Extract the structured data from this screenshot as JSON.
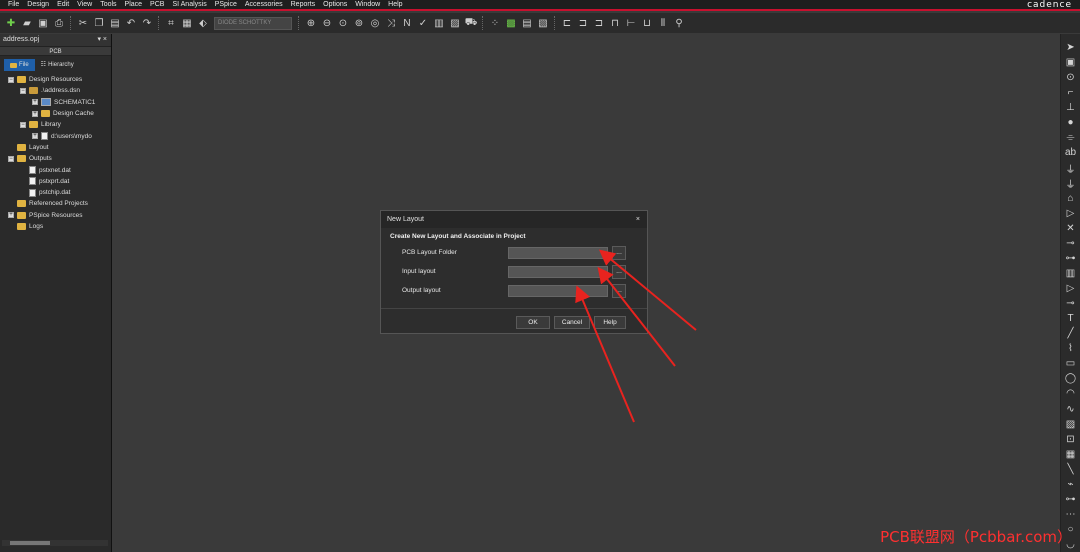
{
  "menu": [
    "File",
    "Design",
    "Edit",
    "View",
    "Tools",
    "Place",
    "PCB",
    "SI Analysis",
    "PSpice",
    "Accessories",
    "Reports",
    "Options",
    "Window",
    "Help"
  ],
  "brand": "cadence",
  "toolbar": {
    "part_select_value": "DIODE SCHOTTKY",
    "icons_left": [
      "new-icon",
      "open-icon",
      "save-icon",
      "print-icon",
      "cut-icon",
      "copy-icon",
      "paste-icon",
      "undo-icon",
      "redo-icon",
      "grid-icon",
      "snap-icon",
      "part-icon"
    ],
    "icons_mid": [
      "zoom-in-icon",
      "zoom-out-icon",
      "zoom-area-icon",
      "zoom-all-icon",
      "fit-icon",
      "cross-probe-icon",
      "netlist-icon",
      "drc-icon",
      "bom-icon",
      "library-icon",
      "cart-icon"
    ],
    "icons_right": [
      "annotate-icon",
      "pcb-editor-icon",
      "report-icon",
      "browse-icon",
      "align-left-icon",
      "align-center-icon",
      "align-right-icon",
      "align-top-icon",
      "align-middle-icon",
      "align-bottom-icon",
      "distribute-icon",
      "pin-icon"
    ]
  },
  "left_panel": {
    "title": "address.opj",
    "close_glyph": "▾ ×",
    "subtitle": "PCB",
    "tabs": [
      "File",
      "Hierarchy"
    ],
    "tree": [
      {
        "indent": 0,
        "type": "folder",
        "label": "Design Resources",
        "expander": "−"
      },
      {
        "indent": 1,
        "type": "dsn",
        "label": ".\\address.dsn",
        "expander": "−"
      },
      {
        "indent": 2,
        "type": "schem",
        "label": "SCHEMATIC1",
        "expander": "+"
      },
      {
        "indent": 2,
        "type": "folder",
        "label": "Design Cache",
        "expander": "+"
      },
      {
        "indent": 1,
        "type": "folder",
        "label": "Library",
        "expander": "−"
      },
      {
        "indent": 2,
        "type": "file",
        "label": "d:\\users\\mydo",
        "expander": "+"
      },
      {
        "indent": 0,
        "type": "folder",
        "label": "Layout",
        "expander": ""
      },
      {
        "indent": 0,
        "type": "folder",
        "label": "Outputs",
        "expander": "−"
      },
      {
        "indent": 1,
        "type": "file",
        "label": "pstxnet.dat",
        "expander": ""
      },
      {
        "indent": 1,
        "type": "file",
        "label": "pstxprt.dat",
        "expander": ""
      },
      {
        "indent": 1,
        "type": "file",
        "label": "pstchip.dat",
        "expander": ""
      },
      {
        "indent": 0,
        "type": "folder",
        "label": "Referenced Projects",
        "expander": ""
      },
      {
        "indent": 0,
        "type": "folder",
        "label": "PSpice Resources",
        "expander": "+"
      },
      {
        "indent": 0,
        "type": "folder",
        "label": "Logs",
        "expander": ""
      }
    ]
  },
  "right_toolbar": [
    "select-icon",
    "place-part-icon",
    "place-net-icon",
    "wire-icon",
    "bus-icon",
    "junction-icon",
    "bus-entry-icon",
    "net-alias-icon",
    "power-icon",
    "ground-icon",
    "off-page-icon",
    "port-icon",
    "no-connect-icon",
    "pin-icon",
    "pin-array-icon",
    "hier-block-icon",
    "hier-port-icon",
    "hier-pin-icon",
    "text-icon",
    "line-icon",
    "polyline-icon",
    "rectangle-icon",
    "ellipse-icon",
    "arc-icon",
    "bezier-icon",
    "image-icon",
    "ieee-icon",
    "parameterized-icon",
    "line-2-icon",
    "auto-wire-icon",
    "auto-connect-icon",
    "bus-auto-icon",
    "circle-icon",
    "elliptical-arc-icon"
  ],
  "dialog": {
    "title": "New Layout",
    "close": "×",
    "heading": "Create New Layout and Associate in Project",
    "fields": [
      {
        "label": "PCB Layout Folder",
        "value": "",
        "browse": "..."
      },
      {
        "label": "Input layout",
        "value": "",
        "browse": "..."
      },
      {
        "label": "Output layout",
        "value": "",
        "browse": "..."
      }
    ],
    "ok": "OK",
    "cancel": "Cancel",
    "help": "Help"
  },
  "watermark": "PCB联盟网（Pcbbar.com）",
  "colors": {
    "accent_line": "#c8102e",
    "arrow": "#e8231f",
    "tab_active": "#1f5fa8"
  }
}
